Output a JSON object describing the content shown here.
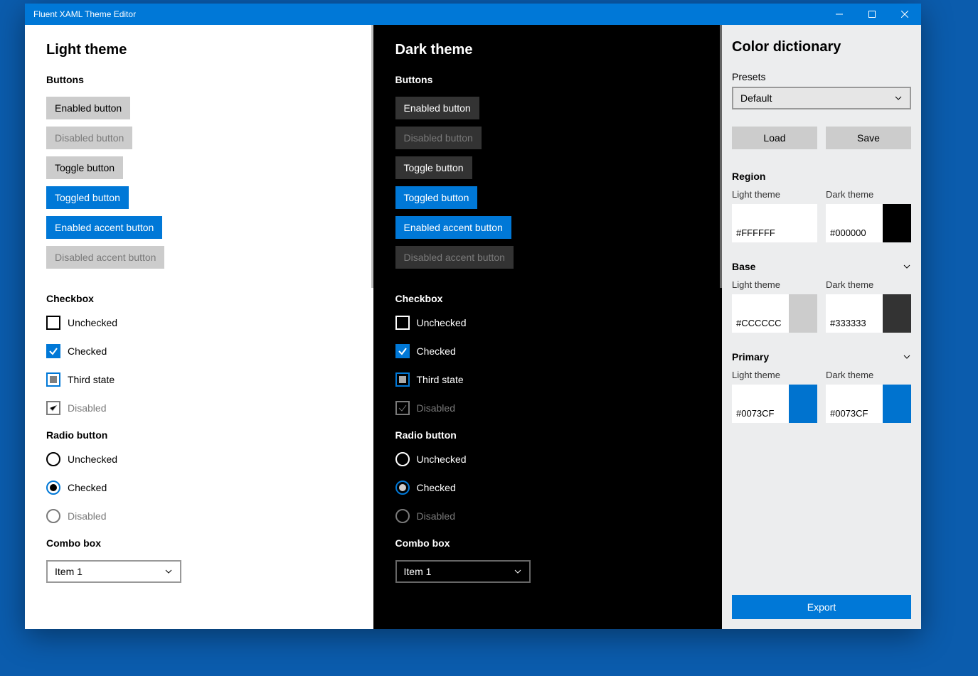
{
  "window": {
    "title": "Fluent XAML Theme Editor"
  },
  "themes": {
    "light_title": "Light theme",
    "dark_title": "Dark theme",
    "buttons_heading": "Buttons",
    "checkbox_heading": "Checkbox",
    "radio_heading": "Radio button",
    "combo_heading": "Combo box",
    "buttons": {
      "enabled": "Enabled button",
      "disabled": "Disabled button",
      "toggle": "Toggle button",
      "toggled": "Toggled button",
      "accent_enabled": "Enabled accent button",
      "accent_disabled": "Disabled accent button"
    },
    "checkbox": {
      "unchecked": "Unchecked",
      "checked": "Checked",
      "third": "Third state",
      "disabled": "Disabled"
    },
    "radio": {
      "unchecked": "Unchecked",
      "checked": "Checked",
      "disabled": "Disabled"
    },
    "combo": {
      "value": "Item 1"
    }
  },
  "side": {
    "title": "Color dictionary",
    "presets_label": "Presets",
    "presets_value": "Default",
    "load": "Load",
    "save": "Save",
    "export": "Export",
    "light_col": "Light theme",
    "dark_col": "Dark theme",
    "region": {
      "title": "Region",
      "light": {
        "hex": "#FFFFFF",
        "color": "#ffffff"
      },
      "dark": {
        "hex": "#000000",
        "color": "#000000"
      }
    },
    "base": {
      "title": "Base",
      "light": {
        "hex": "#CCCCCC",
        "color": "#cccccc"
      },
      "dark": {
        "hex": "#333333",
        "color": "#333333"
      }
    },
    "primary": {
      "title": "Primary",
      "light": {
        "hex": "#0073CF",
        "color": "#0073cf"
      },
      "dark": {
        "hex": "#0073CF",
        "color": "#0073cf"
      }
    }
  }
}
